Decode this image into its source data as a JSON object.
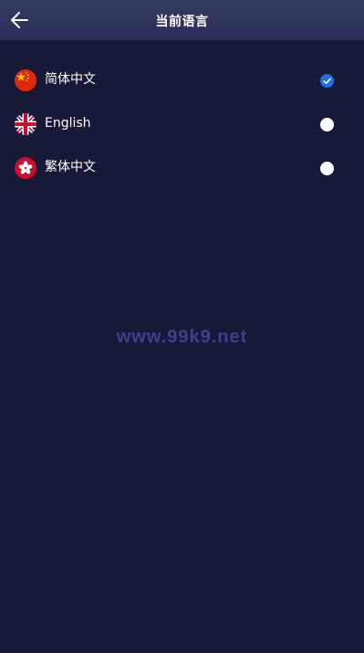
{
  "header": {
    "title": "当前语言",
    "back_icon": "arrow-left-icon"
  },
  "languages": [
    {
      "label": "简体中文",
      "flag_icon": "china-flag-icon",
      "selected": true
    },
    {
      "label": "English",
      "flag_icon": "uk-flag-icon",
      "selected": false
    },
    {
      "label": "繁体中文",
      "flag_icon": "hong-kong-flag-icon",
      "selected": false
    }
  ],
  "watermark": "www.99k9.net",
  "colors": {
    "background": "#171a36",
    "header": "#2f3459",
    "accent": "#1f6feb",
    "watermark": "#3e3f8e"
  }
}
